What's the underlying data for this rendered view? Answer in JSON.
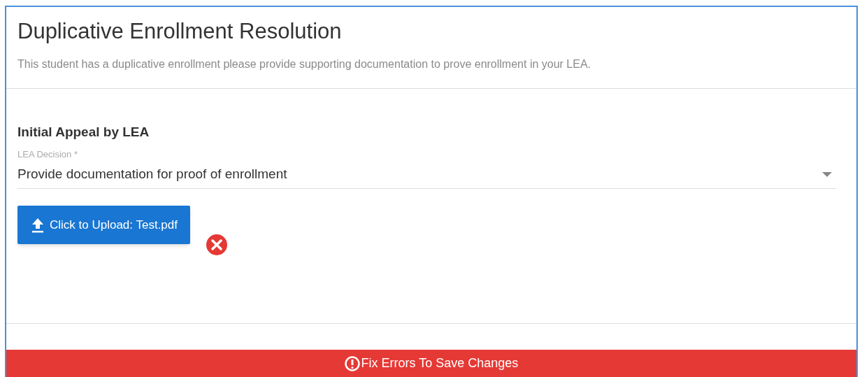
{
  "dialog": {
    "title": "Duplicative Enrollment Resolution",
    "description": "This student has a duplicative enrollment please provide supporting documentation to prove enrollment in your LEA."
  },
  "section": {
    "heading": "Initial Appeal by LEA",
    "field": {
      "label": "LEA Decision *",
      "value": "Provide documentation for proof of enrollment"
    },
    "upload": {
      "label": "Click to Upload: Test.pdf",
      "has_error": true
    }
  },
  "banner": {
    "kind": "error",
    "text": "Fix Errors To Save Changes"
  }
}
